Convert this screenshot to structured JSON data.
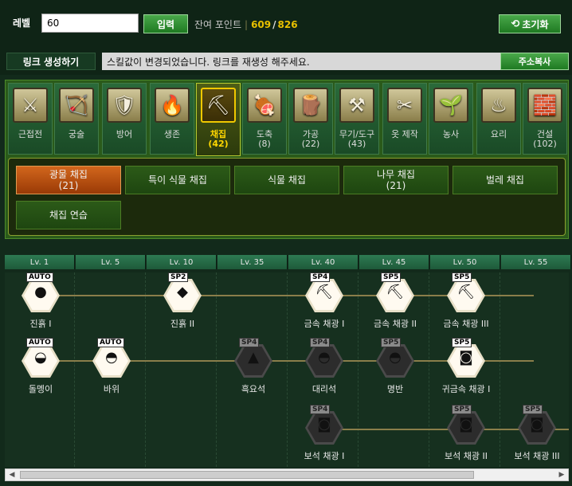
{
  "top": {
    "level_label": "레벨",
    "level_value": "60",
    "input_button": "입력",
    "remain_label": "잔여 포인트",
    "remain_sep": "|",
    "points_left": "609",
    "points_slash": "/",
    "points_total": "826",
    "reset_icon": "refresh-icon",
    "reset_label": "초기화",
    "reset_glyph": "⟲"
  },
  "link": {
    "title": "링크 생성하기",
    "message": "스킬값이 변경되었습니다. 링크를 재생성 해주세요.",
    "copy_button": "주소복사"
  },
  "categories": [
    {
      "name": "근접전",
      "count": "",
      "glyph": "⚔",
      "icon": "spear-icon"
    },
    {
      "name": "궁술",
      "count": "",
      "glyph": "🏹",
      "icon": "bow-icon"
    },
    {
      "name": "방어",
      "count": "",
      "glyph": "🛡",
      "icon": "shield-icon"
    },
    {
      "name": "생존",
      "count": "",
      "glyph": "🔥",
      "icon": "campfire-icon"
    },
    {
      "name": "채집",
      "count": "(42)",
      "glyph": "⛏",
      "icon": "gather-icon"
    },
    {
      "name": "도축",
      "count": "(8)",
      "glyph": "🍖",
      "icon": "meat-icon"
    },
    {
      "name": "가공",
      "count": "(22)",
      "glyph": "🪵",
      "icon": "log-icon"
    },
    {
      "name": "무기/도구",
      "count": "(43)",
      "glyph": "⚒",
      "icon": "anvil-icon"
    },
    {
      "name": "옷 제작",
      "count": "",
      "glyph": "✂",
      "icon": "scissors-icon"
    },
    {
      "name": "농사",
      "count": "",
      "glyph": "🌱",
      "icon": "sprout-icon"
    },
    {
      "name": "요리",
      "count": "",
      "glyph": "♨",
      "icon": "cooking-pot-icon"
    },
    {
      "name": "건설",
      "count": "(102)",
      "glyph": "🧱",
      "icon": "bricks-icon"
    }
  ],
  "subcategories": [
    {
      "name": "광물 채집",
      "count": "(21)"
    },
    {
      "name": "특이 식물 채집",
      "count": ""
    },
    {
      "name": "식물 채집",
      "count": ""
    },
    {
      "name": "나무 채집",
      "count": "(21)"
    },
    {
      "name": "벌레 채집",
      "count": ""
    },
    {
      "name": "채집 연습",
      "count": ""
    }
  ],
  "levels": [
    "Lv. 1",
    "Lv. 5",
    "Lv. 10",
    "Lv. 35",
    "Lv. 40",
    "Lv. 45",
    "Lv. 50",
    "Lv. 55"
  ],
  "skills": [
    {
      "tag": "AUTO",
      "label": "진흙 I",
      "glyph": "●",
      "active": true
    },
    {
      "tag": "SP2",
      "label": "진흙 II",
      "glyph": "◆",
      "active": true
    },
    {
      "tag": "SP4",
      "label": "금속 채광 I",
      "glyph": "⛏",
      "active": true
    },
    {
      "tag": "SP5",
      "label": "금속 채광 II",
      "glyph": "⛏",
      "active": true
    },
    {
      "tag": "SP5",
      "label": "금속 채광 III",
      "glyph": "⛏",
      "active": true
    },
    {
      "tag": "AUTO",
      "label": "돌멩이",
      "glyph": "◒",
      "active": true
    },
    {
      "tag": "AUTO",
      "label": "바위",
      "glyph": "◓",
      "active": true
    },
    {
      "tag": "SP4",
      "label": "흑요석",
      "glyph": "▲",
      "active": false
    },
    {
      "tag": "SP4",
      "label": "대리석",
      "glyph": "◓",
      "active": false
    },
    {
      "tag": "SP5",
      "label": "명반",
      "glyph": "◓",
      "active": false
    },
    {
      "tag": "SP5",
      "label": "귀금속 채광 I",
      "glyph": "◙",
      "active": true
    },
    {
      "tag": "SP4",
      "label": "보석 채광 I",
      "glyph": "◙",
      "active": false
    },
    {
      "tag": "SP5",
      "label": "보석 채광 II",
      "glyph": "◙",
      "active": false
    },
    {
      "tag": "SP5",
      "label": "보석 채광 III",
      "glyph": "◙",
      "active": false
    }
  ],
  "scroll": {
    "left_arrow": "◀",
    "right_arrow": "▶"
  }
}
